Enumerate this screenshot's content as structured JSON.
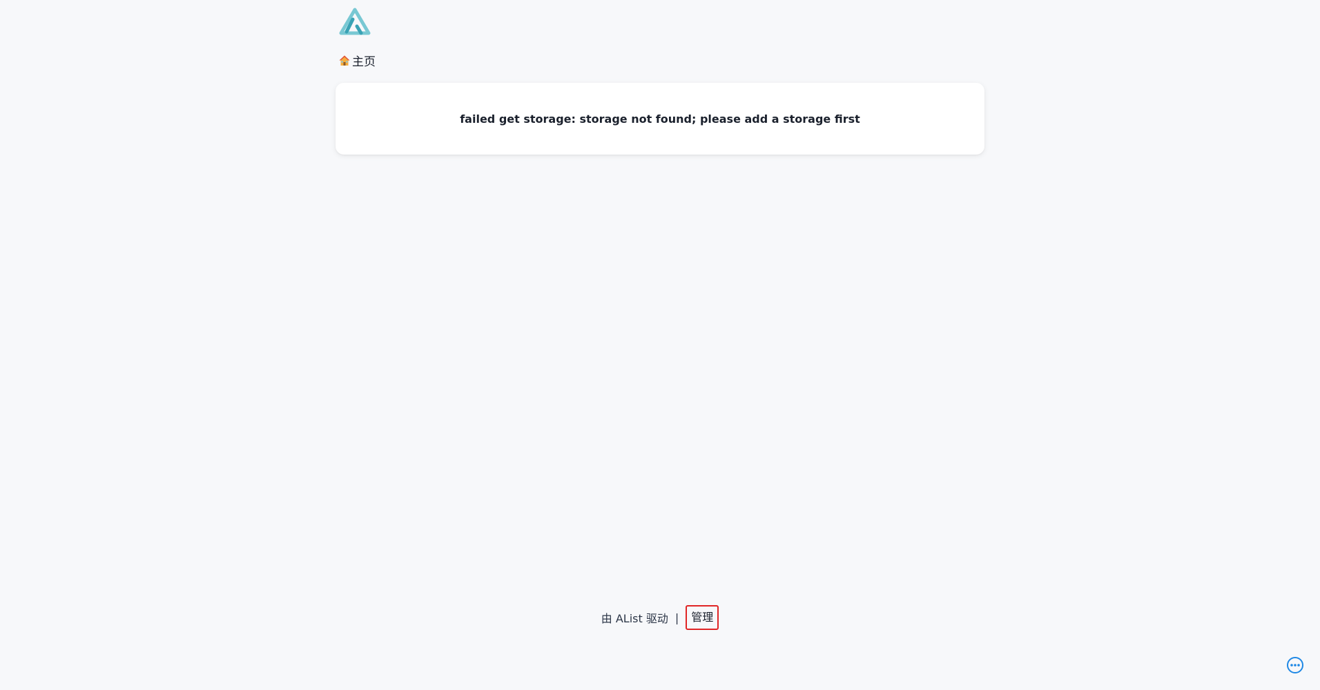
{
  "header": {
    "logo_name": "alist-logo",
    "colors": {
      "logo_light": "#78c8d3",
      "logo_dark": "#3aa3b5"
    }
  },
  "breadcrumb": {
    "home_icon": "house-icon",
    "home_label": "主页"
  },
  "main": {
    "error_message": "failed get storage: storage not found; please add a storage first"
  },
  "footer": {
    "powered_by": "由 AList 驱动",
    "separator": "|",
    "manage_label": "管理",
    "colors": {
      "highlight_border": "#e02424"
    }
  },
  "floating": {
    "more_icon": "ellipsis-circle-icon",
    "colors": {
      "accent": "#1e88e5"
    }
  }
}
